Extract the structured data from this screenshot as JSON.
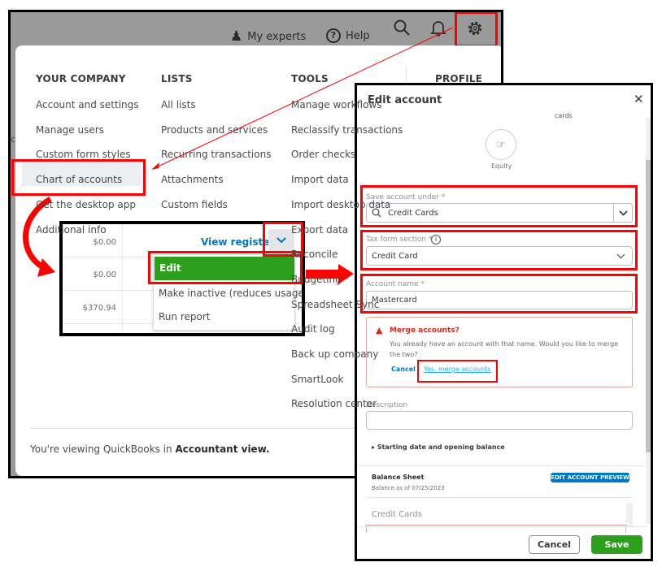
{
  "header": {
    "experts": "My experts",
    "help": "Help"
  },
  "menu": {
    "your_company": {
      "title": "YOUR COMPANY",
      "items": [
        "Account and settings",
        "Manage users",
        "Custom form styles",
        "Chart of accounts",
        "Get the desktop app",
        "Additional info"
      ]
    },
    "lists": {
      "title": "LISTS",
      "items": [
        "All lists",
        "Products and services",
        "Recurring transactions",
        "Attachments",
        "Custom fields"
      ]
    },
    "tools": {
      "title": "TOOLS",
      "items": [
        "Manage workflows",
        "Reclassify transactions",
        "Order checks",
        "Import data",
        "Import desktop data",
        "Export data",
        "Reconcile",
        "Budgeting",
        "Spreadsheet Sync",
        "Audit log",
        "Back up company",
        "SmartLook",
        "Resolution center"
      ]
    },
    "profile": {
      "title": "PROFILE"
    },
    "footer_prefix": "You're viewing QuickBooks in ",
    "footer_bold": "Accountant view."
  },
  "inset": {
    "amounts": [
      "$0.00",
      "$0.00",
      "$370.94"
    ],
    "view_register": "View register",
    "actions": [
      "Edit",
      "Make inactive (reduces usage)",
      "Run report"
    ]
  },
  "dialog": {
    "title": "Edit account",
    "type_caption": "cards",
    "type_label": "Equity",
    "save_under_label": "Save account under *",
    "save_under_value": "Credit Cards",
    "tax_label": "Tax form section *",
    "tax_value": "Credit Card",
    "name_label": "Account name *",
    "name_value": "Mastercard",
    "merge_title": "Merge accounts?",
    "merge_text": "You already have an account with that name. Would you like to merge the two?",
    "merge_cancel": "Cancel",
    "merge_yes": "Yes, merge accounts",
    "description_label": "Description",
    "description_value": "",
    "starting": "Starting date and opening balance",
    "balance_sheet": "Balance Sheet",
    "balance_as_of": "Balance as of 07/25/2023",
    "preview_badge": "EDIT ACCOUNT PREVIEW",
    "preview_row": "Credit Cards",
    "cancel": "Cancel",
    "save": "Save"
  },
  "colors": {
    "green": "#2ca01c",
    "link": "#0077c5",
    "highlight": "#ff0000",
    "error": "#d52b1e"
  }
}
